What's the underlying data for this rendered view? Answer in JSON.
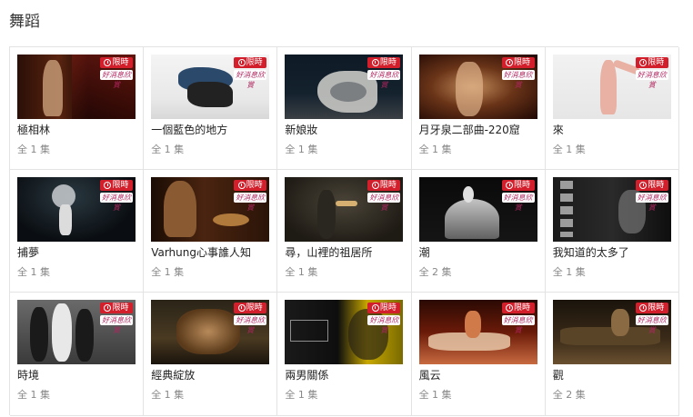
{
  "page": {
    "title": "舞蹈"
  },
  "badges": {
    "limited": "限時",
    "brand": "好消息欣賞"
  },
  "items": [
    {
      "name": "極相林",
      "episodes": "全 1 集"
    },
    {
      "name": "一個藍色的地方",
      "episodes": "全 1 集"
    },
    {
      "name": "新娘妝",
      "episodes": "全 1 集"
    },
    {
      "name": "月牙泉二部曲-220窟",
      "episodes": "全 1 集"
    },
    {
      "name": "來",
      "episodes": "全 1 集"
    },
    {
      "name": "捕夢",
      "episodes": "全 1 集"
    },
    {
      "name": "Varhung心事誰人知",
      "episodes": "全 1 集"
    },
    {
      "name": "尋，山裡的祖居所",
      "episodes": "全 1 集"
    },
    {
      "name": "潮",
      "episodes": "全 2 集"
    },
    {
      "name": "我知道的太多了",
      "episodes": "全 1 集"
    },
    {
      "name": "時境",
      "episodes": "全 1 集"
    },
    {
      "name": "經典綻放",
      "episodes": "全 1 集"
    },
    {
      "name": "兩男關係",
      "episodes": "全 1 集"
    },
    {
      "name": "風云",
      "episodes": "全 1 集"
    },
    {
      "name": "觀",
      "episodes": "全 2 集"
    }
  ]
}
